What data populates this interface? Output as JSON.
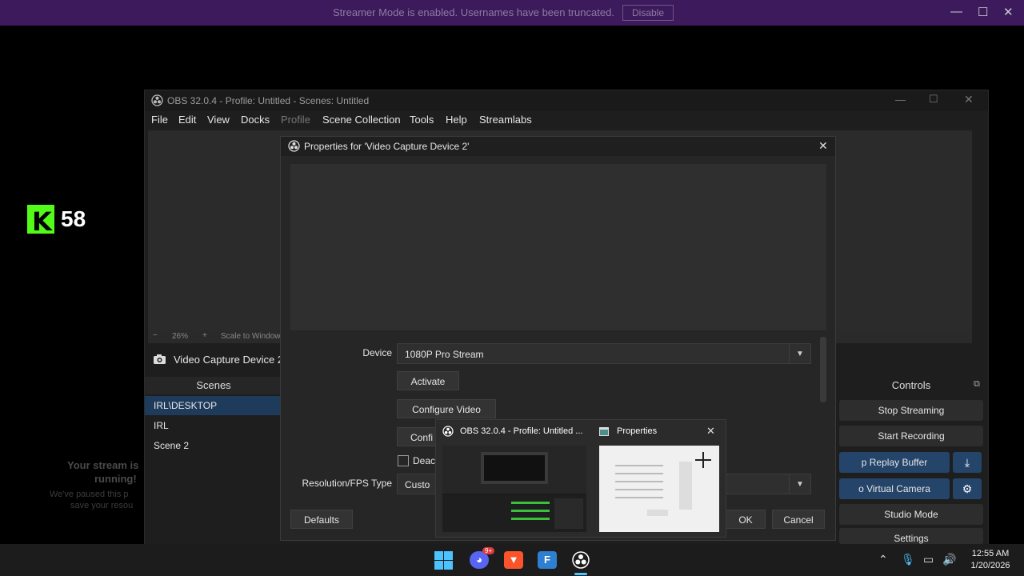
{
  "banner": {
    "message": "Streamer Mode is enabled. Usernames have been truncated.",
    "disable_label": "Disable",
    "minimize": "—",
    "maximize": "☐",
    "close": "✕"
  },
  "kick": {
    "logo_letter": "K",
    "count": "58"
  },
  "background_texts": {
    "line1": "Your stream is",
    "line2": "running!",
    "line3": "We've paused this p",
    "line4": "save your resou"
  },
  "obs": {
    "title": "OBS 32.0.4 - Profile: Untitled - Scenes: Untitled",
    "menu": [
      "File",
      "Edit",
      "View",
      "Docks",
      "Profile",
      "Scene Collection",
      "Tools",
      "Help",
      "Streamlabs"
    ],
    "zoom_minus": "−",
    "zoom_value": "26%",
    "zoom_plus": "+",
    "zoom_mode": "Scale to Window",
    "source_label": "Video Capture Device 2",
    "scenes_header": "Scenes",
    "scenes": [
      "IRL\\DESKTOP",
      "IRL",
      "Scene 2"
    ],
    "controls_header": "Controls",
    "controls": {
      "stop_streaming": "Stop Streaming",
      "start_recording": "Start Recording",
      "replay_buffer": "p Replay Buffer",
      "virtual_camera": "o Virtual Camera",
      "studio_mode": "Studio Mode",
      "settings": "Settings"
    }
  },
  "properties": {
    "title": "Properties for 'Video Capture Device 2'",
    "device_label": "Device",
    "device_value": "1080P Pro Stream",
    "activate_label": "Activate",
    "configure_video_label": "Configure Video",
    "configure_partial": "Confi",
    "deactivate_partial": "Deac",
    "resolution_label": "Resolution/FPS Type",
    "resolution_partial": "Custo",
    "defaults_label": "Defaults",
    "ok_label": "OK",
    "cancel_label": "Cancel"
  },
  "thumbnails": {
    "obs_title": "OBS 32.0.4 - Profile: Untitled ...",
    "props_title": "Properties",
    "close": "✕"
  },
  "taskbar": {
    "discord_badge": "9+",
    "time": "12:55 AM",
    "date": "1/20/2026"
  },
  "colors": {
    "banner_bg": "#3c1a5b",
    "kick_green": "#53fc18",
    "selection_blue": "#1f3b5b"
  }
}
